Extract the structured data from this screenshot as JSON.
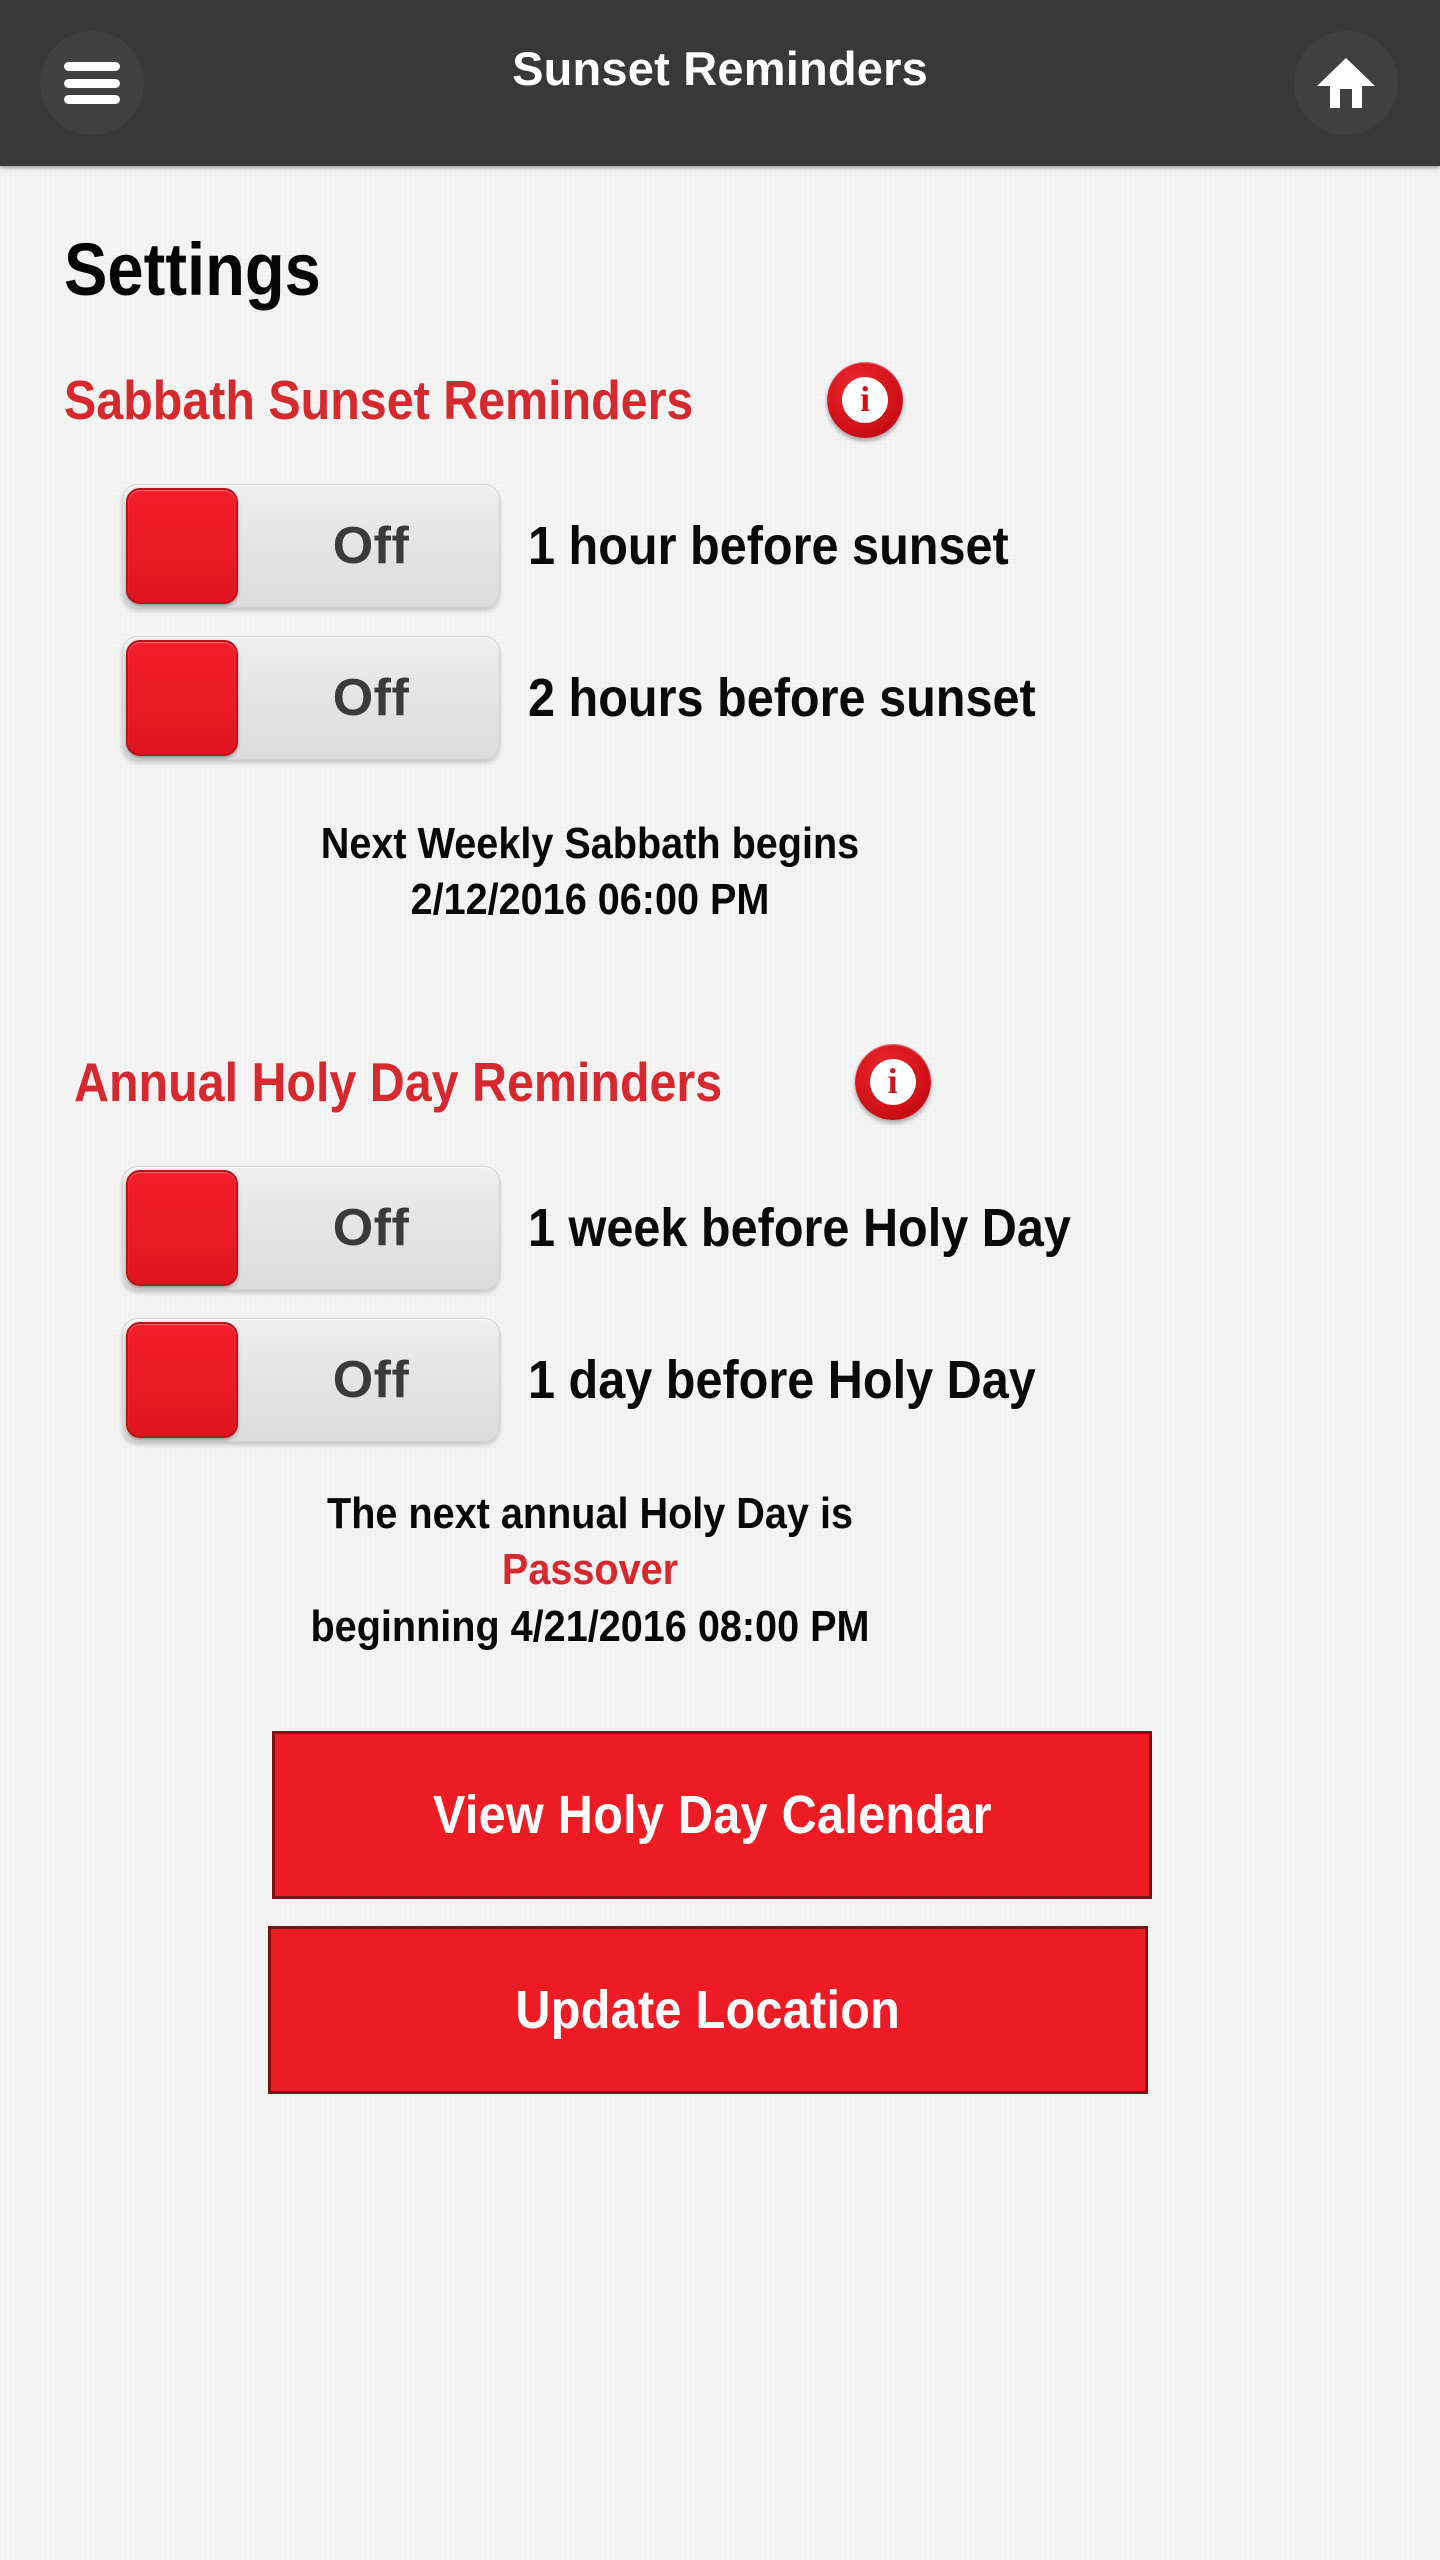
{
  "appbar": {
    "title": "Sunset Reminders",
    "menu_icon": "hamburger-menu-icon",
    "home_icon": "home-icon"
  },
  "page": {
    "title": "Settings"
  },
  "colors": {
    "accent_red": "#d6282f",
    "button_red": "#ed1c24",
    "appbar_bg": "#383838",
    "page_bg": "#f4f4f4",
    "toggle_track": "#e4e4e4",
    "toggle_thumb": "#ed1c24"
  },
  "sections": [
    {
      "heading": "Sabbath Sunset Reminders",
      "info_icon": "info-circle-icon",
      "info_glyph": "i",
      "toggles": [
        {
          "state": "Off",
          "label": "1 hour before sunset"
        },
        {
          "state": "Off",
          "label": "2 hours before sunset"
        }
      ],
      "note": [
        {
          "text": "Next Weekly Sabbath begins",
          "accent": false
        },
        {
          "text": "2/12/2016 06:00 PM",
          "accent": false
        }
      ]
    },
    {
      "heading": "Annual Holy Day Reminders",
      "info_icon": "info-circle-icon",
      "info_glyph": "i",
      "toggles": [
        {
          "state": "Off",
          "label": "1 week before Holy Day"
        },
        {
          "state": "Off",
          "label": "1 day before Holy Day"
        }
      ],
      "note": [
        {
          "text": "The next annual Holy Day is",
          "accent": false
        },
        {
          "text": "Passover",
          "accent": true
        },
        {
          "text": "beginning 4/21/2016 08:00 PM",
          "accent": false
        }
      ]
    }
  ],
  "buttons": [
    {
      "label": "View Holy Day Calendar"
    },
    {
      "label": "Update Location"
    }
  ]
}
